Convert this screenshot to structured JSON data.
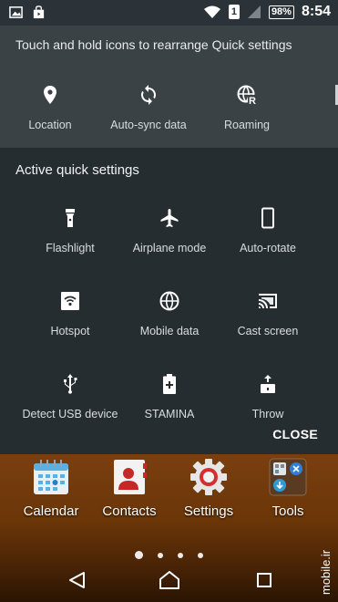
{
  "status_bar": {
    "left_icons": [
      "image-icon",
      "store-bag-icon"
    ],
    "sim_label": "1",
    "battery": "98%",
    "time": "8:54"
  },
  "inactive_section": {
    "hint": "Touch and hold icons to rearrange Quick settings",
    "tiles": [
      {
        "label": "Location",
        "icon": "location-pin-icon"
      },
      {
        "label": "Auto-sync data",
        "icon": "sync-icon"
      },
      {
        "label": "Roaming",
        "icon": "roaming-globe-icon"
      }
    ]
  },
  "active_section": {
    "title": "Active quick settings",
    "tiles": [
      {
        "label": "Flashlight",
        "icon": "flashlight-icon"
      },
      {
        "label": "Airplane mode",
        "icon": "airplane-icon"
      },
      {
        "label": "Auto-rotate",
        "icon": "phone-rotate-icon"
      },
      {
        "label": "Hotspot",
        "icon": "hotspot-icon"
      },
      {
        "label": "Mobile data",
        "icon": "globe-icon"
      },
      {
        "label": "Cast screen",
        "icon": "cast-icon"
      },
      {
        "label": "Detect USB device",
        "icon": "usb-icon"
      },
      {
        "label": "STAMINA",
        "icon": "battery-plus-icon"
      },
      {
        "label": "Throw",
        "icon": "throw-icon"
      }
    ],
    "close_label": "CLOSE"
  },
  "home_dock": {
    "apps": [
      {
        "label": "Calendar",
        "icon": "calendar-app-icon"
      },
      {
        "label": "Contacts",
        "icon": "contacts-app-icon"
      },
      {
        "label": "Settings",
        "icon": "settings-gear-icon"
      },
      {
        "label": "Tools",
        "icon": "tools-folder-icon"
      }
    ],
    "page_count": 4,
    "current_page": 1
  },
  "nav_bar": {
    "buttons": [
      "back-icon",
      "home-icon",
      "recents-icon"
    ]
  },
  "watermark": "mobile.ir",
  "colors": {
    "statusbar_bg": "#2b3338",
    "inactive_bg": "#3a4246",
    "active_bg": "#262d31",
    "wallpaper": "#6b3608"
  }
}
